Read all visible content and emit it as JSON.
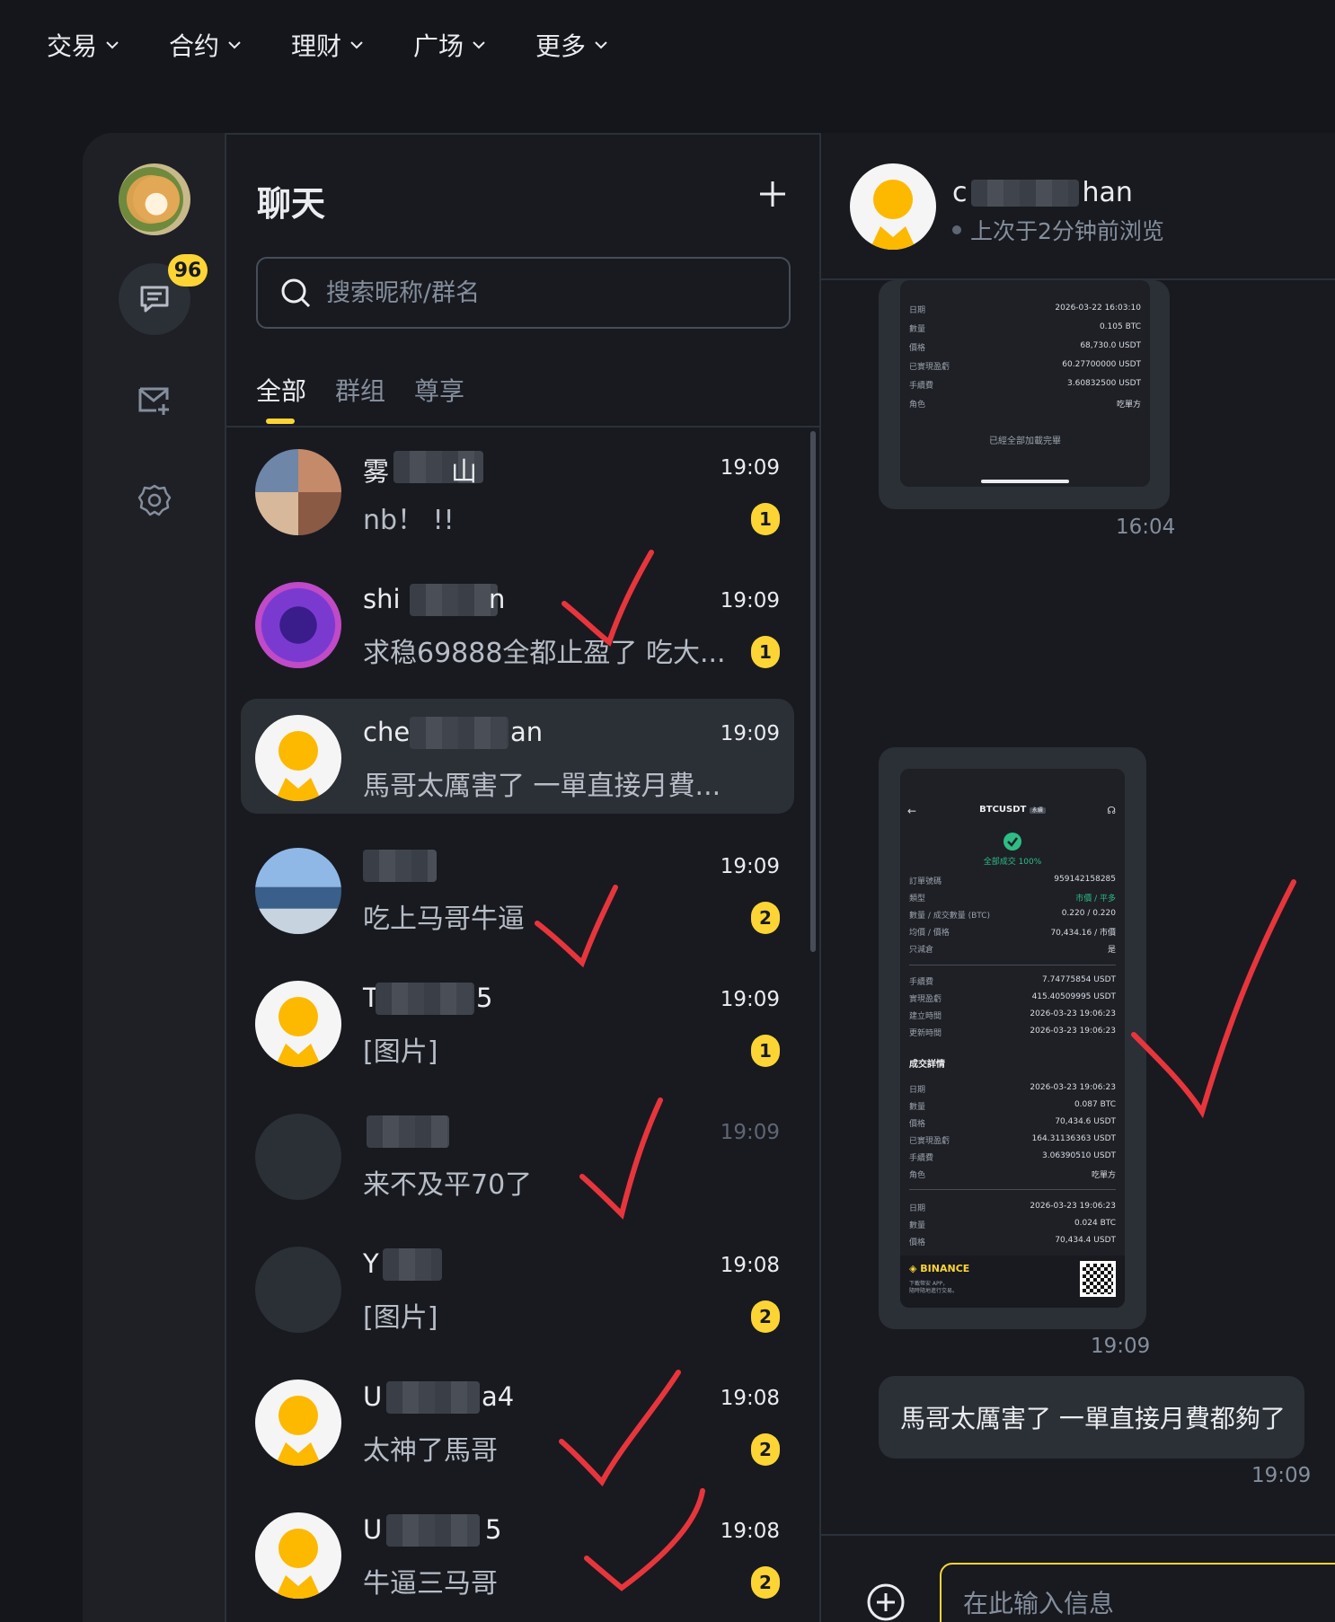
{
  "topnav": {
    "items": [
      {
        "label": "交易"
      },
      {
        "label": "合约"
      },
      {
        "label": "理财"
      },
      {
        "label": "广场"
      },
      {
        "label": "更多"
      }
    ]
  },
  "sidebar": {
    "unread_badge": "96"
  },
  "chat_list": {
    "title": "聊天",
    "search_placeholder": "搜索昵称/群名",
    "tabs": [
      {
        "label": "全部"
      },
      {
        "label": "群组"
      },
      {
        "label": "尊享"
      }
    ],
    "rows": [
      {
        "name": "雾",
        "name_tail": "山",
        "message": "nb！ !!",
        "time": "19:09",
        "unread": "1"
      },
      {
        "name": "shi",
        "name_tail": "n",
        "message": "求稳69888全都止盈了 吃大...",
        "time": "19:09",
        "unread": "1"
      },
      {
        "name": "che",
        "name_tail": "an",
        "message": "馬哥太厲害了 一單直接月費...",
        "time": "19:09",
        "unread": ""
      },
      {
        "name": "",
        "name_tail": "",
        "message": "吃上马哥牛逼",
        "time": "19:09",
        "unread": "2"
      },
      {
        "name": "T",
        "name_tail": "5",
        "message": "[图片]",
        "time": "19:09",
        "unread": "1"
      },
      {
        "name": "",
        "name_tail": "",
        "message": "来不及平70了",
        "time": "19:09",
        "unread": ""
      },
      {
        "name": "Y",
        "name_tail": "",
        "message": "[图片]",
        "time": "19:08",
        "unread": "2"
      },
      {
        "name": "U",
        "name_tail": "a4",
        "message": "太神了馬哥",
        "time": "19:08",
        "unread": "2"
      },
      {
        "name": "U",
        "name_tail": "5",
        "message": "牛逼三马哥",
        "time": "19:08",
        "unread": "2"
      }
    ]
  },
  "conversation": {
    "name_head": "c",
    "name_tail": "han",
    "status": "上次于2分钟前浏览",
    "card1": {
      "rows": [
        {
          "k": "日期",
          "v": "2026-03-22 16:03:10"
        },
        {
          "k": "數量",
          "v": "0.105 BTC"
        },
        {
          "k": "價格",
          "v": "68,730.0 USDT"
        },
        {
          "k": "已實現盈虧",
          "v": "60.27700000 USDT"
        },
        {
          "k": "手續費",
          "v": "3.60832500 USDT"
        },
        {
          "k": "角色",
          "v": "吃單方"
        }
      ],
      "footer": "已經全部加載完畢",
      "time": "16:04"
    },
    "card2": {
      "symbol": "BTCUSDT",
      "symbol_tag": "永續",
      "fill_status": "全部成交 100%",
      "rows_a": [
        {
          "k": "訂單號碼",
          "v": "959142158285"
        },
        {
          "k": "類型",
          "v": "市價 / 平多"
        },
        {
          "k": "數量 / 成交數量 (BTC)",
          "v": "0.220 / 0.220"
        },
        {
          "k": "均價 / 價格",
          "v": "70,434.16 / 市價"
        },
        {
          "k": "只減倉",
          "v": "是"
        }
      ],
      "rows_b": [
        {
          "k": "手續費",
          "v": "7.74775854 USDT"
        },
        {
          "k": "實現盈虧",
          "v": "415.40509995 USDT"
        },
        {
          "k": "建立時間",
          "v": "2026-03-23 19:06:23"
        },
        {
          "k": "更新時間",
          "v": "2026-03-23 19:06:23"
        }
      ],
      "detail_title": "成交詳情",
      "rows_c": [
        {
          "k": "日期",
          "v": "2026-03-23 19:06:23"
        },
        {
          "k": "數量",
          "v": "0.087 BTC"
        },
        {
          "k": "價格",
          "v": "70,434.6 USDT"
        },
        {
          "k": "已實現盈虧",
          "v": "164.31136363 USDT"
        },
        {
          "k": "手續費",
          "v": "3.06390510 USDT"
        },
        {
          "k": "角色",
          "v": "吃單方"
        }
      ],
      "rows_d": [
        {
          "k": "日期",
          "v": "2026-03-23 19:06:23"
        },
        {
          "k": "數量",
          "v": "0.024 BTC"
        },
        {
          "k": "價格",
          "v": "70,434.4 USDT"
        }
      ],
      "brand": "BINANCE",
      "brand_sub1": "下載幣安 APP，",
      "brand_sub2": "隨時隨地進行交易。",
      "time": "19:09"
    },
    "text_message": "馬哥太厲害了 一單直接月費都夠了",
    "text_time": "19:09",
    "composer_placeholder": "在此输入信息"
  },
  "colors": {
    "accent": "#fcd535",
    "background": "#181a20",
    "check_mark": "#e8353c",
    "success": "#2ebd85"
  }
}
